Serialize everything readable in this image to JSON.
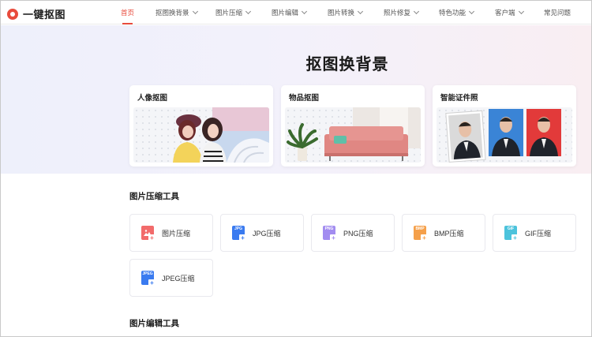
{
  "header": {
    "logo_text": "一键抠图",
    "nav": [
      {
        "label": "首页",
        "active": true,
        "dropdown": false
      },
      {
        "label": "抠图换背景",
        "active": false,
        "dropdown": true
      },
      {
        "label": "图片压缩",
        "active": false,
        "dropdown": true
      },
      {
        "label": "图片编辑",
        "active": false,
        "dropdown": true
      },
      {
        "label": "图片转换",
        "active": false,
        "dropdown": true
      },
      {
        "label": "照片修复",
        "active": false,
        "dropdown": true
      },
      {
        "label": "特色功能",
        "active": false,
        "dropdown": true
      },
      {
        "label": "客户端",
        "active": false,
        "dropdown": true
      },
      {
        "label": "常见问题",
        "active": false,
        "dropdown": false
      }
    ]
  },
  "hero": {
    "title": "抠图换背景",
    "cards": [
      {
        "title": "人像抠图"
      },
      {
        "title": "物品抠图"
      },
      {
        "title": "智能证件照"
      }
    ]
  },
  "compress": {
    "title": "图片压缩工具",
    "tools": [
      {
        "label": "图片压缩",
        "icon": "image-compress-icon",
        "tag": "",
        "color": "#f26b6b"
      },
      {
        "label": "JPG压缩",
        "icon": "jpg-file-icon",
        "tag": "JPG",
        "color": "#3a7bf0"
      },
      {
        "label": "PNG压缩",
        "icon": "png-file-icon",
        "tag": "PNG",
        "color": "#a28cf0"
      },
      {
        "label": "BMP压缩",
        "icon": "bmp-file-icon",
        "tag": "BMP",
        "color": "#f5a04a"
      },
      {
        "label": "GIF压缩",
        "icon": "gif-file-icon",
        "tag": "GIF",
        "color": "#4cc3dc"
      },
      {
        "label": "JPEG压缩",
        "icon": "jpeg-file-icon",
        "tag": "JPEG",
        "color": "#3a7bf0"
      }
    ]
  },
  "edit": {
    "title": "图片编辑工具"
  },
  "colors": {
    "accent": "#e84b3c"
  }
}
